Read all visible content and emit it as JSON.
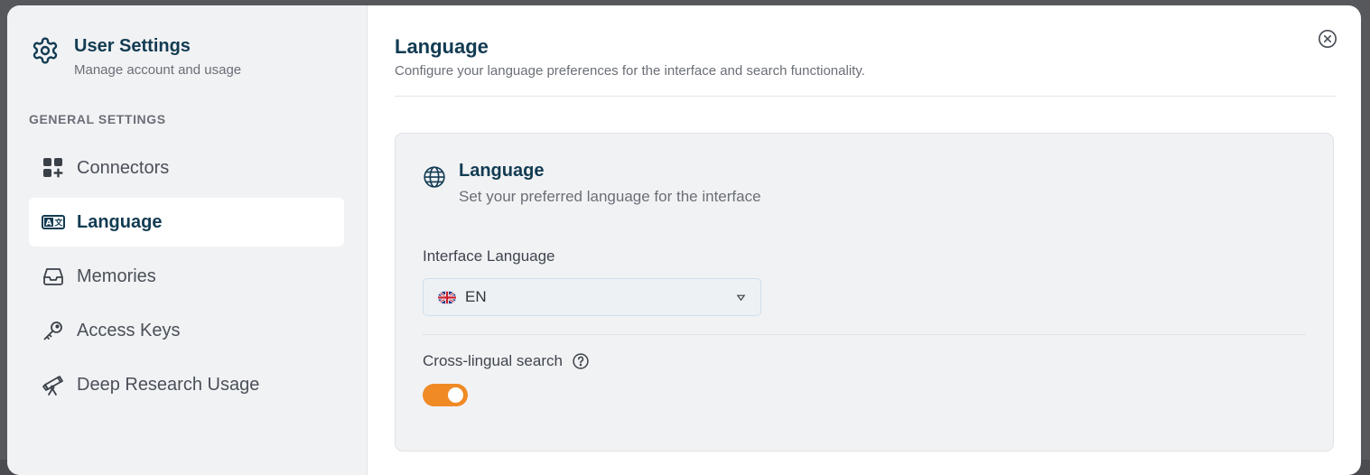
{
  "sidebar": {
    "title": "User Settings",
    "subtitle": "Manage account and usage",
    "section_label": "GENERAL SETTINGS",
    "items": [
      {
        "label": "Connectors",
        "icon": "grid-plus-icon",
        "active": false
      },
      {
        "label": "Language",
        "icon": "translate-icon",
        "active": true
      },
      {
        "label": "Memories",
        "icon": "inbox-icon",
        "active": false
      },
      {
        "label": "Access Keys",
        "icon": "key-icon",
        "active": false
      },
      {
        "label": "Deep Research Usage",
        "icon": "telescope-icon",
        "active": false
      }
    ]
  },
  "main": {
    "title": "Language",
    "subtitle": "Configure your language preferences for the interface and search functionality.",
    "card": {
      "title": "Language",
      "subtitle": "Set your preferred language for the interface",
      "interface_language_label": "Interface Language",
      "interface_language_value": "EN",
      "cross_lingual_label": "Cross-lingual search",
      "cross_lingual_enabled": true
    }
  },
  "colors": {
    "accent": "#f08a24",
    "title": "#123b52",
    "muted": "#6a6f76"
  }
}
